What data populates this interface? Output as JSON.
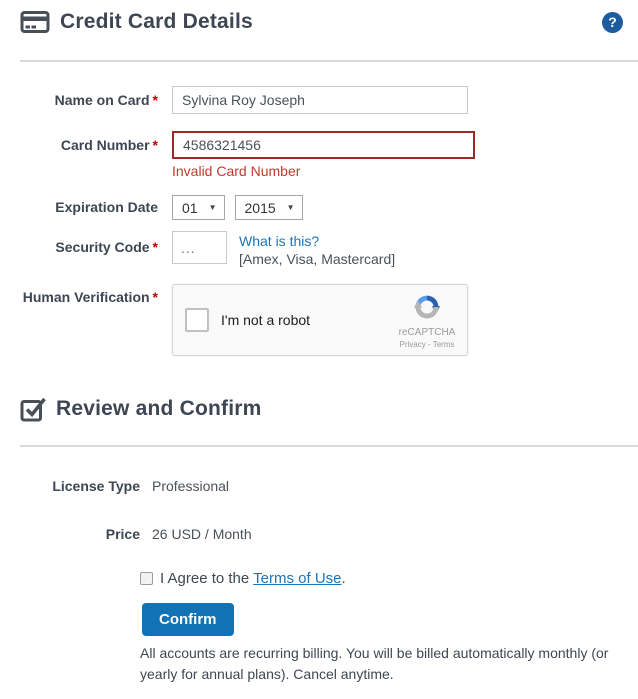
{
  "header": {
    "title": "Credit Card Details"
  },
  "form": {
    "required_marker": "*",
    "name": {
      "label": "Name on Card",
      "value": "Sylvina Roy Joseph"
    },
    "card": {
      "label": "Card Number",
      "value": "4586321456",
      "error": "Invalid Card Number"
    },
    "expiration": {
      "label": "Expiration Date",
      "month": "01",
      "year": "2015"
    },
    "security": {
      "label": "Security Code",
      "placeholder": "...",
      "help_link": "What is this?",
      "hint": "[Amex, Visa, Mastercard]"
    },
    "human": {
      "label": "Human Verification"
    },
    "recaptcha": {
      "checkbox_label": "I'm not a robot",
      "brand": "reCAPTCHA",
      "privacy_link": "Privacy",
      "separator": " - ",
      "terms_link": "Terms"
    }
  },
  "review": {
    "title": "Review and Confirm",
    "license": {
      "label": "License Type",
      "value": "Professional"
    },
    "price": {
      "label": "Price",
      "value": "26 USD / Month"
    },
    "agree": {
      "prefix": "I Agree to the ",
      "link": "Terms of Use",
      "suffix": "."
    },
    "confirm_label": "Confirm",
    "footnote": "All accounts are recurring billing. You will be billed automatically monthly (or yearly for annual plans). Cancel anytime."
  },
  "icons": {
    "select_arrow": "▼",
    "help_glyph": "?"
  },
  "colors": {
    "accent_blue": "#1173b5",
    "link_blue": "#1b75bb",
    "help_blue": "#1d5c9e",
    "error_red": "#bf3b2f",
    "invalid_border_red": "#9e2a25",
    "label_dark": "#3e4653",
    "required_red": "#c00000"
  }
}
